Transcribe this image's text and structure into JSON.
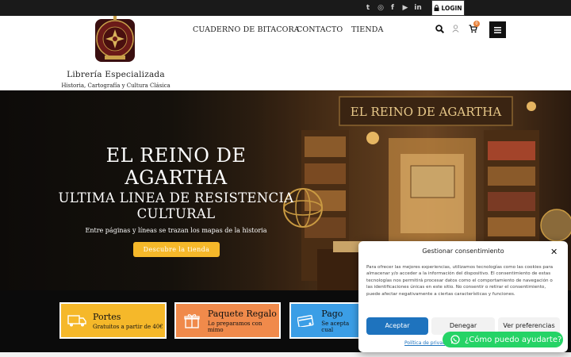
{
  "topbar": {
    "social_icons": [
      "twitter-icon",
      "instagram-icon",
      "facebook-icon",
      "youtube-icon",
      "linkedin-icon"
    ],
    "social_glyphs": [
      "t",
      "◎",
      "f",
      "▶",
      "in"
    ],
    "login_label": "LOGIN"
  },
  "header": {
    "brand_name": "Librería Especializada",
    "brand_subtitle": "Historia, Cartografía y Cultura Clásica",
    "nav": [
      "CUADERNO DE BITACORA",
      "CONTACTO",
      "TIENDA"
    ],
    "cart_count": "0"
  },
  "hero": {
    "title": "EL REINO DE AGARTHA",
    "subtitle": "ULTIMA LINEA DE RESISTENCIA CULTURAL",
    "tagline": "Entre páginas y líneas se trazan los mapas de la historia",
    "button_label": "Descubre la tienda",
    "sign_text": "EL REINO DE AGARTHA"
  },
  "features": [
    {
      "title": "Portes",
      "subtitle": "Gratuitos a partir de 40€",
      "color": "#f5b82a",
      "icon": "truck-icon"
    },
    {
      "title": "Paquete Regalo",
      "subtitle": "Lo preparamos con mimo",
      "color": "#f08a4b",
      "icon": "gift-icon"
    },
    {
      "title": "Pago",
      "subtitle": "Se acepta cual",
      "color": "#3b9ee6",
      "icon": "credit-card-icon"
    }
  ],
  "consent": {
    "title": "Gestionar consentimiento",
    "text": "Para ofrecer las mejores experiencias, utilizamos tecnologías como las cookies para almacenar y/o acceder a la información del dispositivo. El consentimiento de estas tecnologías nos permitirá procesar datos como el comportamiento de navegación o las identificaciones únicas en este sitio. No consentir o retirar el consentimiento, puede afectar negativamente a ciertas características y funciones.",
    "accept_label": "Aceptar",
    "deny_label": "Denegar",
    "prefs_label": "Ver preferencias",
    "policy_link": "Política de privac"
  },
  "whatsapp": {
    "label": "¿Cómo puedo ayudarte?"
  },
  "colors": {
    "topbar": "#1a1a1a",
    "accent_yellow": "#f5b82a",
    "accent_orange": "#f08a4b",
    "accent_blue": "#3b9ee6",
    "consent_accept": "#1e73be",
    "whatsapp": "#25d366"
  }
}
